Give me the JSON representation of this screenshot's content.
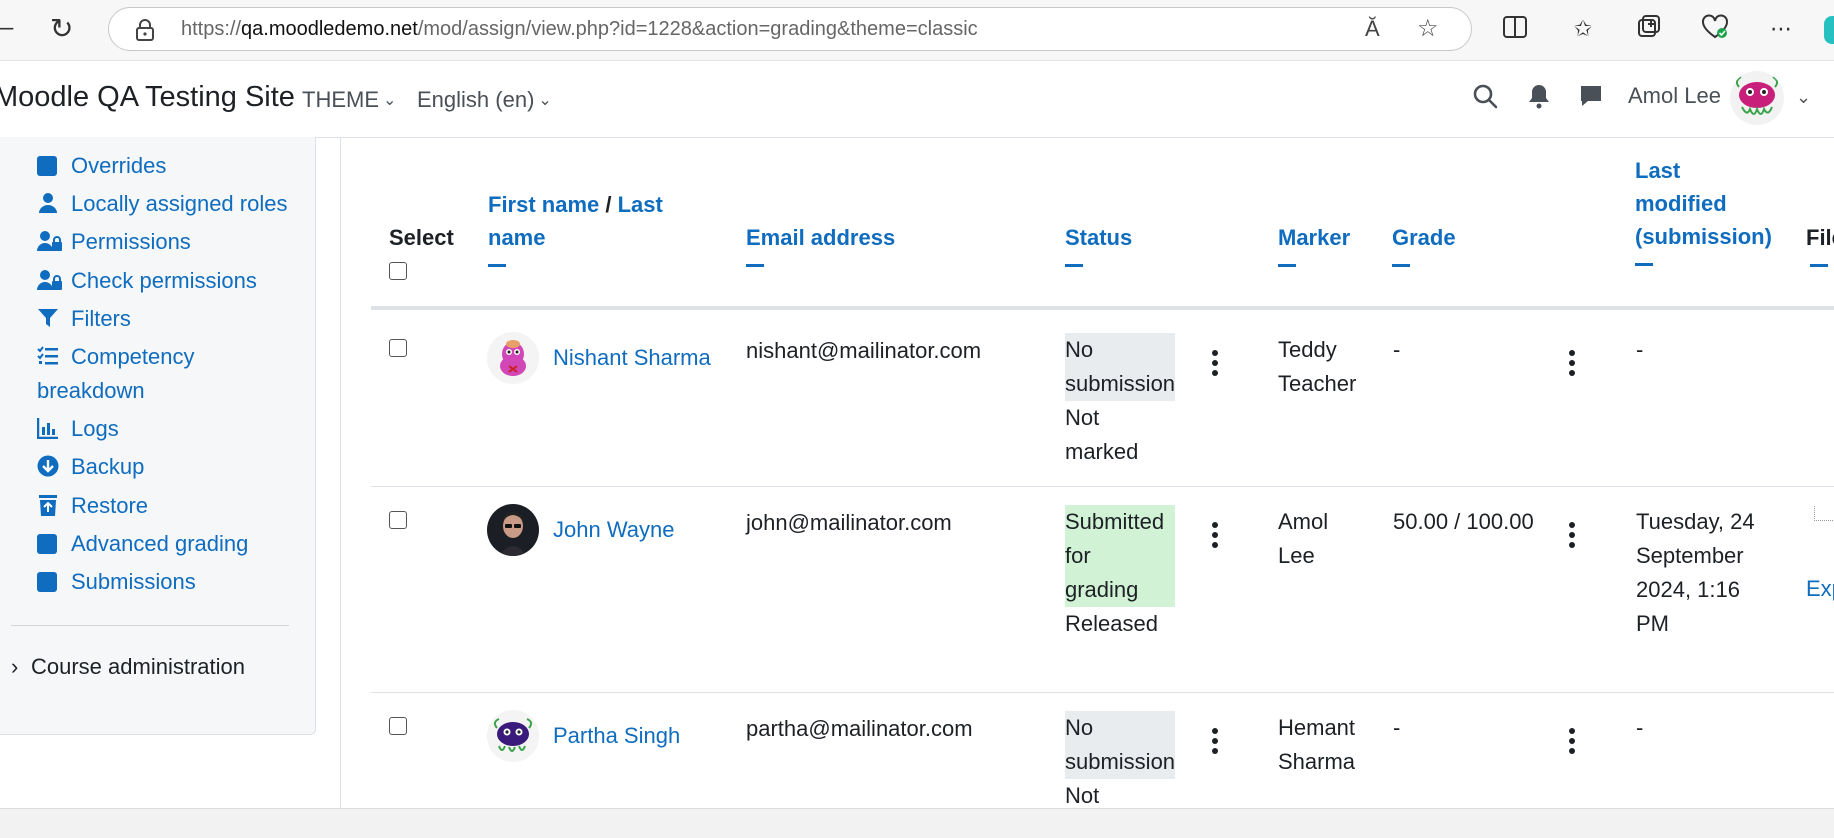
{
  "browser": {
    "url_prefix": "https://",
    "url_host": "qa.moodledemo.net",
    "url_path": "/mod/assign/view.php?id=1228&action=grading&theme=classic",
    "read_aloud_glyph": "Ă",
    "back_glyph": "–",
    "refresh_glyph": "↻"
  },
  "navbar": {
    "site_name": "Moodle QA Testing Site",
    "theme_menu": "THEME",
    "language_menu": "English (en)",
    "user_name": "Amol Lee"
  },
  "drawer": {
    "items": [
      {
        "label": "Overrides",
        "icon": "square-icon"
      },
      {
        "label": "Locally assigned roles",
        "icon": "user-icon"
      },
      {
        "label": "Permissions",
        "icon": "users-lock-icon"
      },
      {
        "label": "Check permissions",
        "icon": "users-lock-icon"
      },
      {
        "label": "Filters",
        "icon": "filter-icon"
      },
      {
        "label": "Competency",
        "label2": "breakdown",
        "icon": "list-check-icon"
      },
      {
        "label": "Logs",
        "icon": "chart-icon"
      },
      {
        "label": "Backup",
        "icon": "download-circle-icon"
      },
      {
        "label": "Restore",
        "icon": "trash-restore-icon"
      },
      {
        "label": "Advanced grading",
        "icon": "square-icon"
      },
      {
        "label": "Submissions",
        "icon": "square-icon"
      }
    ],
    "course_admin": "Course administration"
  },
  "table": {
    "headers": {
      "select": "Select",
      "first_name": "First name",
      "sep": " / ",
      "last_name_1": "Last",
      "last_name_2": "name",
      "email": "Email address",
      "status": "Status",
      "marker": "Marker",
      "grade": "Grade",
      "last_modified_1": "Last",
      "last_modified_2": "modified",
      "last_modified_3": "(submission)",
      "files_partial": "File"
    },
    "rows": [
      {
        "name": "Nishant Sharma",
        "email": "nishant@mailinator.com",
        "status_badge": [
          "No",
          "submission"
        ],
        "status_badge_color": "#e9ecef",
        "status_extra": [
          "Not",
          "marked"
        ],
        "marker": [
          "Teddy",
          "Teacher"
        ],
        "grade": "-",
        "last_modified": [
          "-"
        ]
      },
      {
        "name": "John Wayne",
        "email": "john@mailinator.com",
        "status_badge": [
          "Submitted",
          "for",
          "grading"
        ],
        "status_badge_color": "#d2f2d6",
        "status_extra": [
          "Released"
        ],
        "marker": [
          "Amol",
          "Lee"
        ],
        "grade": "50.00 / 100.00",
        "last_modified": [
          "Tuesday, 24",
          "September",
          "2024, 1:16",
          "PM"
        ],
        "files_partial": "Exp"
      },
      {
        "name": "Partha Singh",
        "email": "partha@mailinator.com",
        "status_badge": [
          "No",
          "submission"
        ],
        "status_badge_color": "#e9ecef",
        "status_extra": [
          "Not"
        ],
        "marker": [
          "Hemant",
          "Sharma"
        ],
        "grade": "-",
        "last_modified": [
          "-"
        ]
      }
    ]
  },
  "colors": {
    "link": "#0f6cbf",
    "text": "#1d2125",
    "drawer_bg": "#f5f7f9"
  }
}
